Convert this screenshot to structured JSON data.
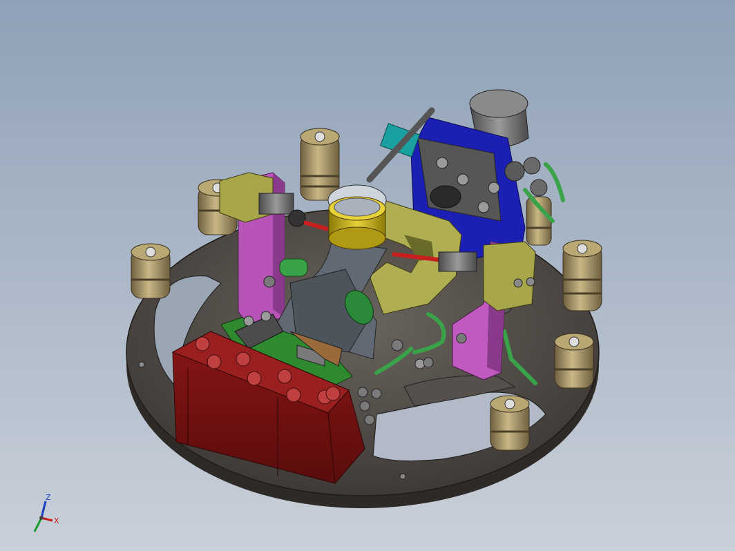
{
  "viewport": {
    "background_top": "#8fa1b7",
    "background_bottom": "#c9d0d9"
  },
  "triad": {
    "z_label": "Z",
    "x_label": "X",
    "z_color": "#1a3fc4",
    "x_color": "#c81e1e",
    "y_color": "#1a9a2a"
  },
  "colors": {
    "base_plate": "#4f4a46",
    "red_block": "#7a1212",
    "magenta_bracket": "#c05ac0",
    "olive_block": "#a8a64a",
    "blue_cylinder": "#1b1fb4",
    "gold_ring": "#c9b21a",
    "bronze_column": "#9c8a5a",
    "green_hose": "#3aa34a",
    "teal_block": "#1aa0a0"
  }
}
